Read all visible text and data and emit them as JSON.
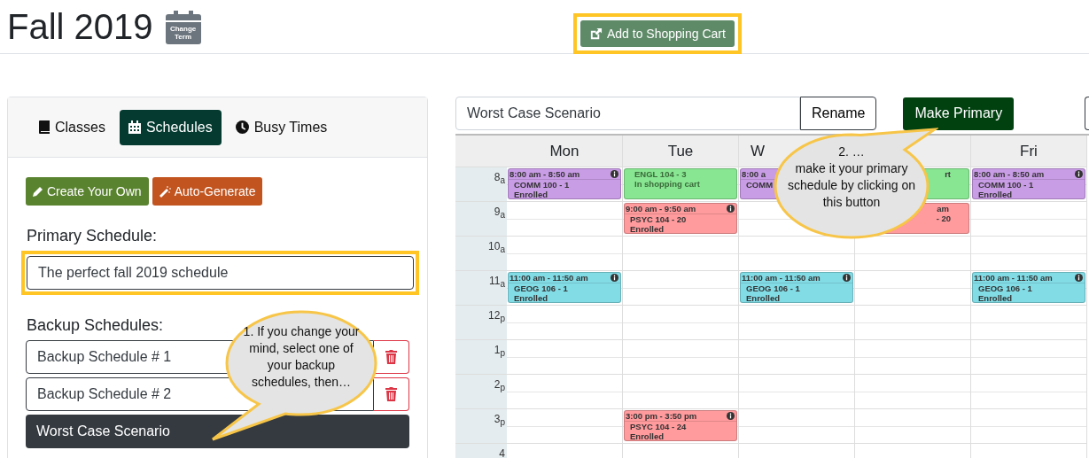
{
  "header": {
    "term": "Fall 2019",
    "change_term": [
      "Change",
      "Term"
    ],
    "cart_button": "Add to Shopping Cart"
  },
  "sidebar": {
    "tabs": [
      {
        "label": "Classes",
        "selected": false
      },
      {
        "label": "Schedules",
        "selected": true
      },
      {
        "label": "Busy Times",
        "selected": false
      }
    ],
    "create_button": "Create Your Own",
    "generate_button": "Auto-Generate",
    "primary_label": "Primary Schedule:",
    "primary_value": "The perfect fall 2019 schedule",
    "backup_label": "Backup Schedules:",
    "backups": [
      {
        "name": "Backup Schedule # 1",
        "selected": false
      },
      {
        "name": "Backup Schedule # 2",
        "selected": false
      },
      {
        "name": "Worst Case Scenario",
        "selected": true
      }
    ]
  },
  "schedule": {
    "name_value": "Worst Case Scenario",
    "rename_button": "Rename",
    "primary_button": "Make Primary",
    "days": [
      {
        "label": "Mon",
        "kind": "whole"
      },
      {
        "label": "Tue",
        "kind": "whole"
      },
      {
        "label": "W",
        "kind": "cut"
      },
      {
        "kind": "covered"
      },
      {
        "label": "Fri",
        "kind": "whole"
      }
    ],
    "rows": [
      {
        "label": "8$_{a}$",
        "cells": [
          {
            "kind": "full",
            "color": "#c99ce6",
            "time": "8:00 am - 8:50 am",
            "course": "COMM 100 - 1",
            "status": "Enrolled"
          },
          {
            "kind": "top-cut",
            "color": "#88e592",
            "course": "ENGL 104 - 3",
            "status": "In shopping cart"
          },
          {
            "kind": "full",
            "color": "#c99ce6",
            "time": "8:00 a",
            "course": "COMM"
          },
          {
            "kind": "partial",
            "color": "#88e592",
            "status": "rt"
          },
          {
            "kind": "full",
            "color": "#c99ce6",
            "time": "8:00 am - 8:50 am",
            "course": "COMM 100 - 1",
            "status": "Enrolled"
          }
        ]
      },
      {
        "label": "9$_{a}$",
        "cells": [
          null,
          {
            "kind": "full",
            "color": "#ff9a9d",
            "time": "9:00 am - 9:50 am",
            "course": "PSYC 104 - 20",
            "status": "Enrolled"
          },
          null,
          {
            "kind": "partial",
            "color": "#ff9a9d",
            "time": "am",
            "course": "- 20"
          },
          null
        ]
      },
      {
        "label": "10$_{a}$",
        "cells": [
          null,
          null,
          null,
          null,
          null
        ]
      },
      {
        "label": "11$_{a}$",
        "cells": [
          {
            "kind": "full",
            "color": "#82dce6",
            "time": "11:00 am - 11:50 am",
            "course": "GEOG 106 - 1",
            "status": "Enrolled"
          },
          null,
          {
            "kind": "full",
            "color": "#82dce6",
            "time": "11:00 am - 11:50 am",
            "course": "GEOG 106 - 1",
            "status": "Enrolled"
          },
          null,
          {
            "kind": "full",
            "color": "#82dce6",
            "time": "11:00 am - 11:50 am",
            "course": "GEOG 106 - 1",
            "status": "Enrolled"
          }
        ]
      },
      {
        "label": "12$_{p}$",
        "cells": [
          null,
          null,
          null,
          null,
          null
        ]
      },
      {
        "label": "1$_{p}$",
        "cells": [
          null,
          null,
          null,
          null,
          null
        ]
      },
      {
        "label": "2$_{p}$",
        "cells": [
          null,
          null,
          null,
          null,
          null
        ]
      },
      {
        "label": "3$_{p}$",
        "cells": [
          null,
          {
            "kind": "full",
            "color": "#ff9a9d",
            "time": "3:00 pm - 3:50 pm",
            "course": "PSYC 104 - 24",
            "status": "Enrolled"
          },
          null,
          null,
          null
        ]
      },
      {
        "label": "4",
        "cells": [
          null,
          null,
          null,
          null,
          null
        ]
      }
    ]
  },
  "callouts": [
    "1. If you change your mind, select one of your backup schedules, then…",
    "2. …\nmake it your primary schedule by clicking on this button"
  ]
}
